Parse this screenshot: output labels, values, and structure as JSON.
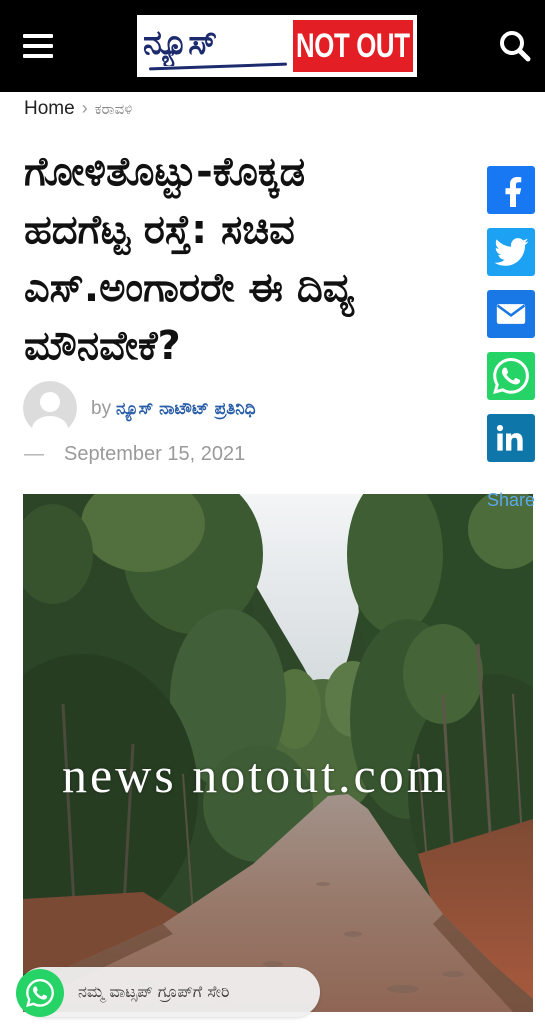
{
  "header": {
    "background": "#000000",
    "menu_icon": "hamburger-menu-icon",
    "search_icon": "search-icon",
    "logo": {
      "kannada_text": "ನ್ಯೂಸ್",
      "latin_text": "NOT OUT",
      "text_color": "#1c2b6e",
      "accent_color": "#e31e24"
    }
  },
  "breadcrumb": {
    "home": "Home",
    "separator": "›",
    "category": "ಕರಾವಳಿ"
  },
  "article": {
    "title_lines": [
      "ಗೋಳಿತೊಟ್ಟು-ಕೊಕ್ಕಡ",
      "ಹದಗೆಟ್ಟ ರಸ್ತೆ: ಸಚಿವ",
      "ಎಸ್.ಅಂಗಾರರೇ ಈ ದಿವ್ಯ",
      "ಮೌನವೇಕೆ?"
    ],
    "author": {
      "avatar_icon": "default-avatar-icon",
      "prefix": "by",
      "name": "ನ್ಯೂಸ್ ನಾಟೌಟ್ ಪ್ರತಿನಿಧಿ",
      "name_color": "#2a5ea8"
    },
    "date": {
      "dash": "—",
      "text": "September 15, 2021"
    },
    "image": {
      "watermark": "news notout.com"
    }
  },
  "share": {
    "label": "Share",
    "label_color": "#5aa9e6",
    "buttons": [
      {
        "icon": "facebook-icon",
        "color": "#1877f2"
      },
      {
        "icon": "twitter-icon",
        "color": "#1da1f2"
      },
      {
        "icon": "email-icon",
        "color": "#1a78e6"
      },
      {
        "icon": "whatsapp-icon",
        "color": "#25d366"
      },
      {
        "icon": "linkedin-icon",
        "color": "#0e76a8"
      }
    ]
  },
  "whatsapp_cta": {
    "icon": "whatsapp-icon",
    "label": "ನಮ್ಮ ವಾಟ್ಸಪ್ ಗ್ರೂಪ್‌ಗೆ ಸೇರಿ",
    "color": "#25d366"
  }
}
